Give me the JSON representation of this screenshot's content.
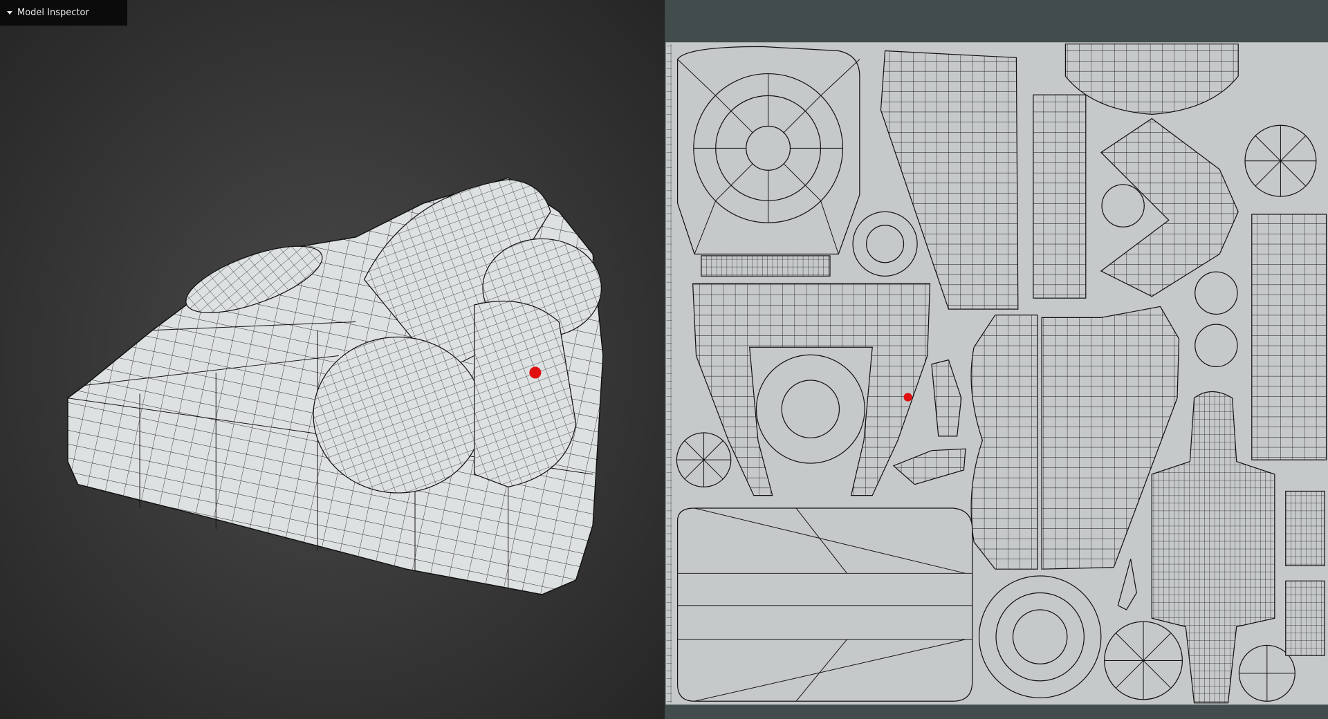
{
  "panel": {
    "title": "Model Inspector",
    "toggle_icon": "caret-down-icon"
  },
  "colors": {
    "viewport_bg_center": "#4a4a4a",
    "viewport_bg_edge": "#262626",
    "uv_panel_bg": "#424c4d",
    "uv_texture_bg": "#c6c9ca",
    "mesh_fill": "#dde1e2",
    "marker": "#e01010"
  }
}
